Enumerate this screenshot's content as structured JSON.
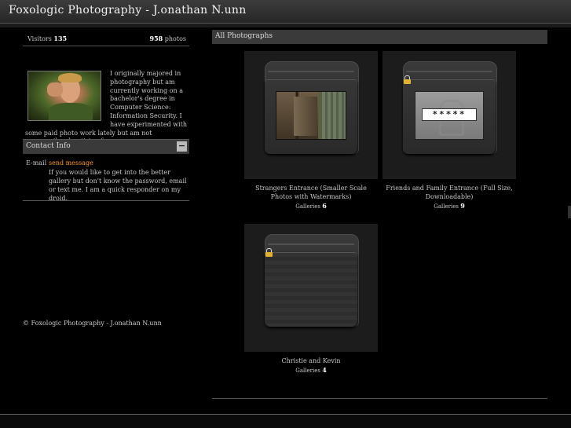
{
  "header": {
    "title": "Foxologic Photography - J.onathan N.unn"
  },
  "sidebar": {
    "visitors_label": "Visitors",
    "visitors_count": "135",
    "photos_count": "958",
    "photos_label": "photos",
    "bio": "I originally majored in photography but am currently working on a bachelor's degree in Computer Science: Information Security. I have experimented with some paid photo work lately but am not necessarily advertising for more.",
    "contact_title": "Contact Info",
    "collapse_symbol": "−",
    "contact_label": "E-mail",
    "contact_link": "send message",
    "contact_note": "If you would like to get into the better gallery but don't know the password, email or text me. I am a quick responder on my droid.",
    "copyright": "© Foxologic Photography - J.onathan N.unn"
  },
  "main": {
    "title": "All Photographs",
    "galleries": [
      {
        "name": "Strangers Entrance (Smaller Scale Photos with Watermarks)",
        "count_label": "Galleries",
        "count": "6",
        "locked": false
      },
      {
        "name": "Friends and Family Entrance (Full Size, Downloadable)",
        "count_label": "Galleries",
        "count": "9",
        "locked": true,
        "password_mask": "*****"
      },
      {
        "name": "Christie and Kevin",
        "count_label": "Galleries",
        "count": "4",
        "locked": true
      }
    ]
  },
  "icons": {
    "lock": "lock-icon",
    "folder": "folder-icon",
    "minus": "minus-icon"
  },
  "colors": {
    "background": "#000000",
    "panel": "#3a3a3a",
    "link": "#ff9a2a",
    "text": "#c8c8c8"
  }
}
